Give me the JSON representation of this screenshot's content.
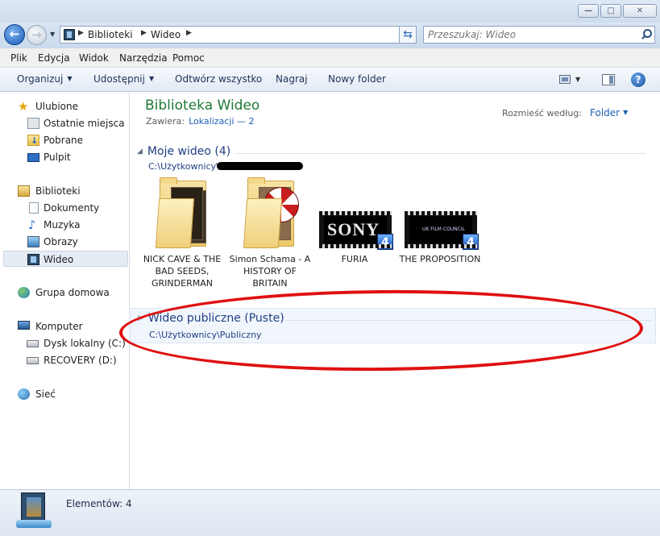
{
  "window": {
    "minimize_glyph": "—",
    "maximize_glyph": "□",
    "close_glyph": "✕"
  },
  "address": {
    "breadcrumb": [
      "Biblioteki",
      "Wideo"
    ],
    "search_placeholder": "Przeszukaj: Wideo"
  },
  "menu": [
    "Plik",
    "Edycja",
    "Widok",
    "Narzędzia",
    "Pomoc"
  ],
  "commands": {
    "organize": "Organizuj",
    "share": "Udostępnij",
    "play_all": "Odtwórz wszystko",
    "burn": "Nagraj",
    "new_folder": "Nowy folder"
  },
  "nav": {
    "favorites": {
      "label": "Ulubione",
      "items": [
        "Ostatnie miejsca",
        "Pobrane",
        "Pulpit"
      ]
    },
    "libraries": {
      "label": "Biblioteki",
      "items": [
        "Dokumenty",
        "Muzyka",
        "Obrazy",
        "Wideo"
      ]
    },
    "homegroup": "Grupa domowa",
    "computer": {
      "label": "Komputer",
      "items": [
        "Dysk lokalny (C:)",
        "RECOVERY (D:)"
      ]
    },
    "network": "Sieć"
  },
  "library": {
    "title": "Biblioteka Wideo",
    "contains_label": "Zawiera:",
    "locations_link": "Lokalizacji — 2",
    "arrange_label": "Rozmieść według:",
    "arrange_value": "Folder"
  },
  "groups": {
    "mine": {
      "title": "Moje wideo (4)",
      "path": "C:\\Użytkownicy\\",
      "items": [
        {
          "label": "NICK CAVE & THE BAD SEEDS, GRINDERMAN"
        },
        {
          "label": "Simon Schama - A HISTORY OF BRITAIN"
        },
        {
          "label": "FURIA",
          "thumb_text": "SONY",
          "badge": "4"
        },
        {
          "label": "THE PROPOSITION",
          "thumb_text": "UK FILM COUNCIL",
          "badge": "4"
        }
      ]
    },
    "public": {
      "title": "Wideo publiczne (Puste)",
      "path": "C:\\Użytkownicy\\Publiczny"
    }
  },
  "status": {
    "items_count": "Elementów: 4"
  },
  "colors": {
    "library_title": "#1e7a36",
    "link": "#1e5fb4",
    "annotation": "#e01010"
  }
}
